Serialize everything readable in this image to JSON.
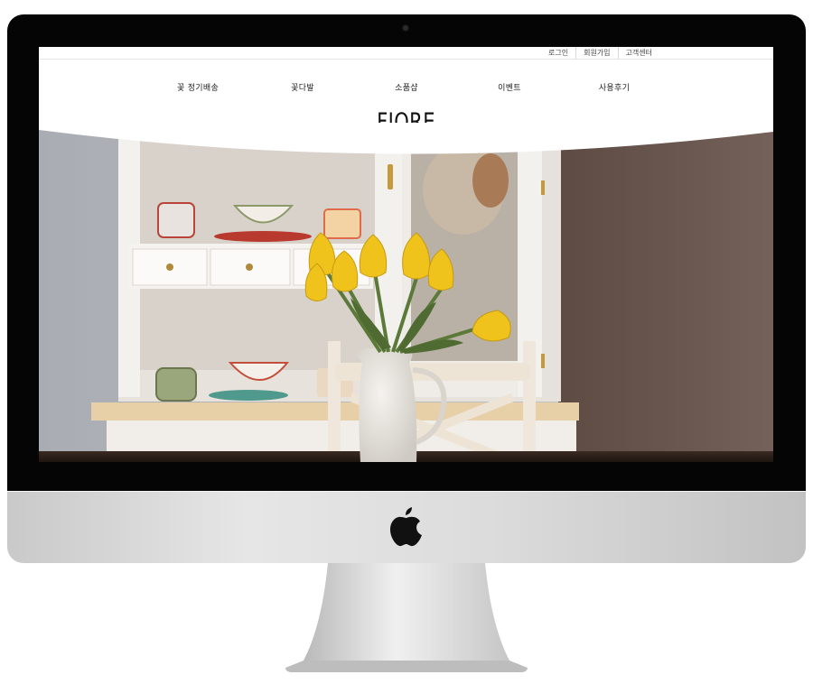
{
  "util_links": [
    "로그인",
    "회원가입",
    "고객센터"
  ],
  "nav": [
    "꽃 정기배송",
    "꽃다발",
    "소품샵",
    "이벤트",
    "사용후기"
  ],
  "brand": {
    "logo": "FIORE"
  },
  "icons": {
    "apple": "apple-logo-icon",
    "camera": "camera-icon"
  },
  "colors": {
    "bezel": "#050505",
    "tulip": "#f0c21c",
    "wall_right": "#6e5b52",
    "cabinet": "#f1eeea"
  }
}
